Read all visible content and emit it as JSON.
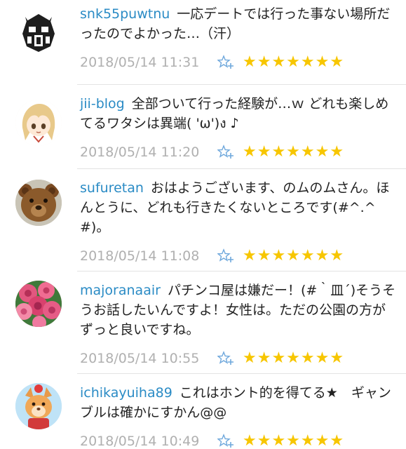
{
  "comments": [
    {
      "username": "snk55puwtnu",
      "text": "一応デートでは行った事ない場所だったのでよかった…（汗）",
      "timestamp": "2018/05/14 11:31",
      "avatar_icon": "robot-helmet-avatar",
      "stars": "★★★★★★★"
    },
    {
      "username": "jii-blog",
      "text": "全部ついて行った経験が…ｗ どれも楽しめてるワタシは異端( 'ω')ง ♪",
      "timestamp": "2018/05/14 11:20",
      "avatar_icon": "anime-girl-avatar",
      "stars": "★★★★★★★"
    },
    {
      "username": "sufuretan",
      "text": "おはようございます、のムのムさん。ほんとうに、どれも行きたくないところです(#^.^#)。",
      "timestamp": "2018/05/14 11:08",
      "avatar_icon": "teddy-bear-avatar",
      "stars": "★★★★★★★"
    },
    {
      "username": "majoranaair",
      "text": "パチンコ屋は嫌だー！(#｀皿´)そうそうお話したいんですよ！女性は。ただの公園の方がずっと良いですね。",
      "timestamp": "2018/05/14 10:55",
      "avatar_icon": "roses-avatar",
      "stars": "★★★★★★★"
    },
    {
      "username": "ichikayuiha89",
      "text": "これはホント的を得てる★　ギャンブルは確かにすかん@@",
      "timestamp": "2018/05/14 10:49",
      "avatar_icon": "fox-character-avatar",
      "stars": "★★★★★★★"
    }
  ],
  "colors": {
    "username": "#2a8bc5",
    "timestamp": "#b0b0b0",
    "star": "#f7c600",
    "add_star_icon": "#6fa8dc"
  },
  "add_star_icon": "star-plus-icon"
}
